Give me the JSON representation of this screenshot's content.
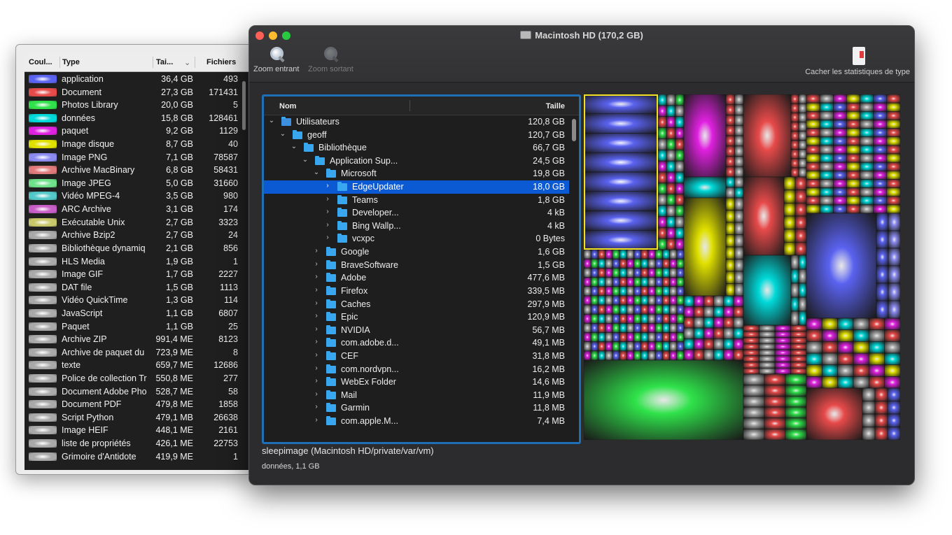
{
  "type_stats": {
    "headers": {
      "color": "Coul...",
      "type": "Type",
      "size": "Tai...",
      "files": "Fichiers"
    },
    "rows": [
      {
        "type": "application",
        "size": "36,4 GB",
        "files": "493",
        "color": "#5a62f0"
      },
      {
        "type": "Document",
        "size": "27,3 GB",
        "files": "171431",
        "color": "#e84a4a"
      },
      {
        "type": "Photos Library",
        "size": "20,0 GB",
        "files": "5",
        "color": "#2fe24a"
      },
      {
        "type": "données",
        "size": "15,8 GB",
        "files": "128461",
        "color": "#00d9d9"
      },
      {
        "type": "paquet",
        "size": "9,2 GB",
        "files": "1129",
        "color": "#e020e0"
      },
      {
        "type": "Image disque",
        "size": "8,7 GB",
        "files": "40",
        "color": "#e0e000"
      },
      {
        "type": "Image PNG",
        "size": "7,1 GB",
        "files": "78587",
        "color": "#8a8af0"
      },
      {
        "type": "Archive MacBinary",
        "size": "6,8 GB",
        "files": "58431",
        "color": "#e07a7a"
      },
      {
        "type": "Image JPEG",
        "size": "5,0 GB",
        "files": "31660",
        "color": "#6ee38a"
      },
      {
        "type": "Vidéo MPEG-4",
        "size": "3,5 GB",
        "files": "980",
        "color": "#52c8c8"
      },
      {
        "type": "ARC Archive",
        "size": "3,1 GB",
        "files": "174",
        "color": "#c75ec7"
      },
      {
        "type": "Exécutable Unix",
        "size": "2,7 GB",
        "files": "3323",
        "color": "#c8c86a"
      },
      {
        "type": "Archive Bzip2",
        "size": "2,7 GB",
        "files": "24",
        "color": "#a9a9a9"
      },
      {
        "type": "Bibliothèque dynamiq",
        "size": "2,1 GB",
        "files": "856",
        "color": "#a9a9a9"
      },
      {
        "type": "HLS Media",
        "size": "1,9 GB",
        "files": "1",
        "color": "#a9a9a9"
      },
      {
        "type": "Image GIF",
        "size": "1,7 GB",
        "files": "2227",
        "color": "#a9a9a9"
      },
      {
        "type": "DAT file",
        "size": "1,5 GB",
        "files": "1113",
        "color": "#a9a9a9"
      },
      {
        "type": "Vidéo QuickTime",
        "size": "1,3 GB",
        "files": "114",
        "color": "#a9a9a9"
      },
      {
        "type": "JavaScript",
        "size": "1,1 GB",
        "files": "6807",
        "color": "#a9a9a9"
      },
      {
        "type": "Paquet",
        "size": "1,1 GB",
        "files": "25",
        "color": "#a9a9a9"
      },
      {
        "type": "Archive ZIP",
        "size": "991,4 ME",
        "files": "8123",
        "color": "#a9a9a9"
      },
      {
        "type": "Archive de paquet du",
        "size": "723,9 ME",
        "files": "8",
        "color": "#a9a9a9"
      },
      {
        "type": "texte",
        "size": "659,7 ME",
        "files": "12686",
        "color": "#a9a9a9"
      },
      {
        "type": "Police de collection Tr",
        "size": "550,8 ME",
        "files": "277",
        "color": "#a9a9a9"
      },
      {
        "type": "Document Adobe Pho",
        "size": "528,7 ME",
        "files": "58",
        "color": "#a9a9a9"
      },
      {
        "type": "Document PDF",
        "size": "479,8 ME",
        "files": "1858",
        "color": "#a9a9a9"
      },
      {
        "type": "Script Python",
        "size": "479,1 MB",
        "files": "26638",
        "color": "#a9a9a9"
      },
      {
        "type": "Image HEIF",
        "size": "448,1 ME",
        "files": "2161",
        "color": "#a9a9a9"
      },
      {
        "type": "liste de propriétés",
        "size": "426,1 ME",
        "files": "22753",
        "color": "#a9a9a9"
      },
      {
        "type": "Grimoire d'Antidote",
        "size": "419,9 ME",
        "files": "1",
        "color": "#a9a9a9"
      }
    ]
  },
  "main_window": {
    "title": "Macintosh HD (170,2 GB)",
    "toolbar": {
      "zoom_in": "Zoom entrant",
      "zoom_out": "Zoom sortant",
      "hide_stats": "Cacher les statistiques de type"
    },
    "outline": {
      "col_name": "Nom",
      "col_size": "Taille",
      "rows": [
        {
          "name": "Utilisateurs",
          "size": "120,8 GB",
          "depth": 0,
          "expanded": true,
          "kind": "user"
        },
        {
          "name": "geoff",
          "size": "120,7 GB",
          "depth": 1,
          "expanded": true,
          "kind": "folder"
        },
        {
          "name": "Bibliothèque",
          "size": "66,7 GB",
          "depth": 2,
          "expanded": true,
          "kind": "folder"
        },
        {
          "name": "Application Sup...",
          "size": "24,5 GB",
          "depth": 3,
          "expanded": true,
          "kind": "folder"
        },
        {
          "name": "Microsoft",
          "size": "19,8 GB",
          "depth": 4,
          "expanded": true,
          "kind": "folder"
        },
        {
          "name": "EdgeUpdater",
          "size": "18,0 GB",
          "depth": 5,
          "expanded": false,
          "kind": "folder",
          "selected": true
        },
        {
          "name": "Teams",
          "size": "1,8 GB",
          "depth": 5,
          "expanded": false,
          "kind": "folder"
        },
        {
          "name": "Developer...",
          "size": "4 kB",
          "depth": 5,
          "expanded": false,
          "kind": "folder"
        },
        {
          "name": "Bing Wallp...",
          "size": "4 kB",
          "depth": 5,
          "expanded": false,
          "kind": "folder"
        },
        {
          "name": "vcxpc",
          "size": "0 Bytes",
          "depth": 5,
          "expanded": false,
          "kind": "folder"
        },
        {
          "name": "Google",
          "size": "1,6 GB",
          "depth": 4,
          "expanded": false,
          "kind": "folder"
        },
        {
          "name": "BraveSoftware",
          "size": "1,5 GB",
          "depth": 4,
          "expanded": false,
          "kind": "folder"
        },
        {
          "name": "Adobe",
          "size": "477,6 MB",
          "depth": 4,
          "expanded": false,
          "kind": "folder"
        },
        {
          "name": "Firefox",
          "size": "339,5 MB",
          "depth": 4,
          "expanded": false,
          "kind": "folder"
        },
        {
          "name": "Caches",
          "size": "297,9 MB",
          "depth": 4,
          "expanded": false,
          "kind": "folder"
        },
        {
          "name": "Epic",
          "size": "120,9 MB",
          "depth": 4,
          "expanded": false,
          "kind": "folder"
        },
        {
          "name": "NVIDIA",
          "size": "56,7 MB",
          "depth": 4,
          "expanded": false,
          "kind": "folder"
        },
        {
          "name": "com.adobe.d...",
          "size": "49,1 MB",
          "depth": 4,
          "expanded": false,
          "kind": "folder"
        },
        {
          "name": "CEF",
          "size": "31,8 MB",
          "depth": 4,
          "expanded": false,
          "kind": "folder"
        },
        {
          "name": "com.nordvpn...",
          "size": "16,2 MB",
          "depth": 4,
          "expanded": false,
          "kind": "folder"
        },
        {
          "name": "WebEx Folder",
          "size": "14,6 MB",
          "depth": 4,
          "expanded": false,
          "kind": "folder"
        },
        {
          "name": "Mail",
          "size": "11,9 MB",
          "depth": 4,
          "expanded": false,
          "kind": "folder"
        },
        {
          "name": "Garmin",
          "size": "11,8 MB",
          "depth": 4,
          "expanded": false,
          "kind": "folder"
        },
        {
          "name": "com.apple.M...",
          "size": "7,4 MB",
          "depth": 4,
          "expanded": false,
          "kind": "folder"
        }
      ]
    },
    "status": {
      "path": "sleepimage (Macintosh HD/private/var/vm)",
      "type_info": "données, 1,1 GB"
    },
    "colors": {
      "selection": "#0b5ad3",
      "focus_ring": "#1f6fb6",
      "highlight_box": "#f0e020"
    }
  }
}
